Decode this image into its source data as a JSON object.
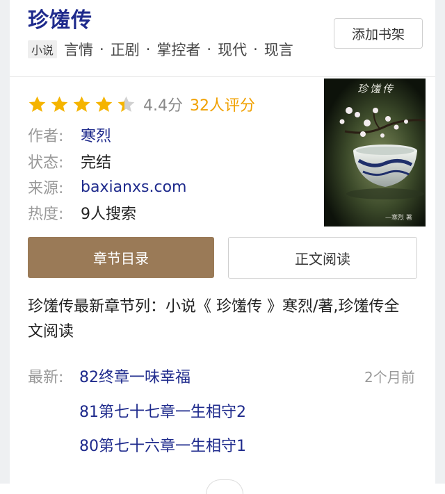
{
  "book": {
    "title": "珍馐传",
    "type_badge": "小说",
    "tags": [
      "言情",
      "正剧",
      "掌控者",
      "现代",
      "现言"
    ],
    "tag_separator": "·",
    "add_shelf_label": "添加书架"
  },
  "rating": {
    "stars_filled": 4.4,
    "stars_total": 5,
    "score_text": "4.4分",
    "count_text": "32人评分",
    "star_color": "#f5b400",
    "star_empty_color": "#d0d0d0"
  },
  "info": {
    "author_label": "作者:",
    "author": "寒烈",
    "status_label": "状态:",
    "status": "完结",
    "source_label": "来源:",
    "source": "baxianxs.com",
    "heat_label": "热度:",
    "heat": "9人搜索"
  },
  "cover": {
    "title_text": "珍馐传",
    "signature_text": "—寒烈 著"
  },
  "actions": {
    "toc_label": "章节目录",
    "read_label": "正文阅读"
  },
  "description": "珍馐传最新章节列：小说《 珍馐传 》寒烈/著,珍馐传全文阅读",
  "latest": {
    "label": "最新:",
    "chapters": [
      {
        "title": "82终章一味幸福",
        "time": "2个月前"
      },
      {
        "title": "81第七十七章一生相守2"
      },
      {
        "title": "80第七十六章一生相守1"
      }
    ]
  },
  "colors": {
    "title_blue": "#1e2a8c",
    "toc_button_bg": "#9a7a57",
    "rating_count": "#f0a000"
  }
}
